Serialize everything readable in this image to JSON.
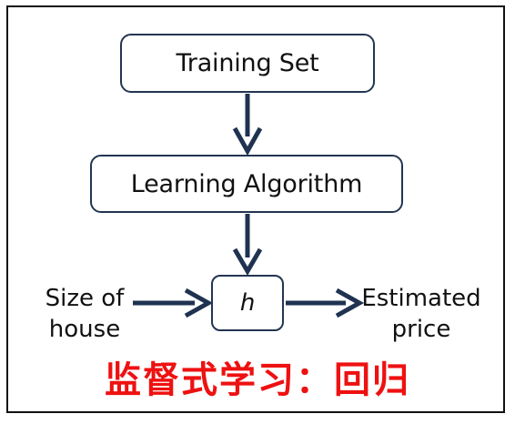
{
  "nodes": {
    "training_set": "Training Set",
    "learning_algorithm": "Learning Algorithm",
    "hypothesis": "h"
  },
  "input": {
    "line1": "Size of",
    "line2": "house"
  },
  "output": {
    "line1": "Estimated",
    "line2": "price"
  },
  "caption": "监督式学习：回归",
  "colors": {
    "box_border": "#233551",
    "arrow": "#1f3250",
    "caption": "#ee1111",
    "frame": "#111111"
  }
}
